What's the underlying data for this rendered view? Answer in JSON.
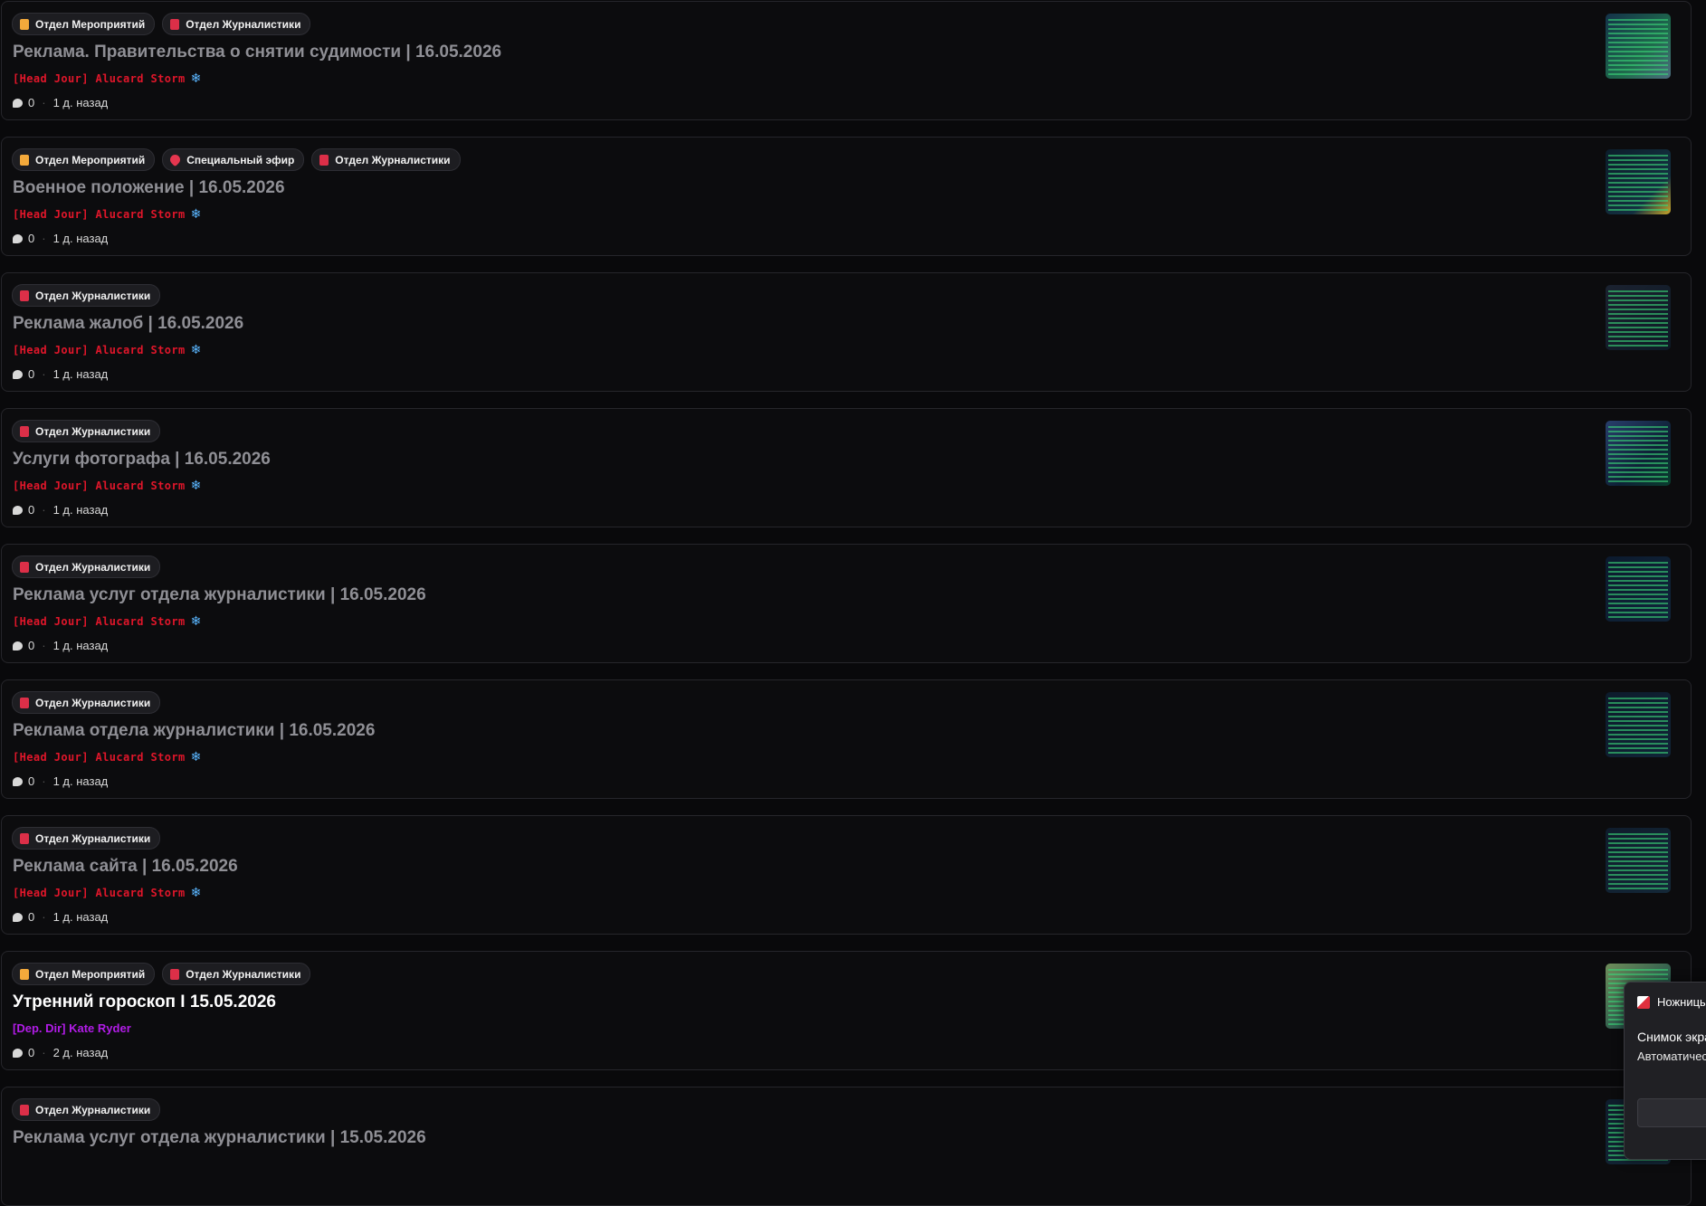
{
  "posts": [
    {
      "tags": [
        {
          "label": "Отдел Мероприятий",
          "icon": "folder-icon"
        },
        {
          "label": "Отдел Журналистики",
          "icon": "book-icon"
        }
      ],
      "title": "Реклама. Правительства о снятии судимости | 16.05.2026",
      "unread": false,
      "author": "[Head Jour] Alucard Storm",
      "author_style": "red",
      "has_snowflake": true,
      "comments": "0",
      "time": "1 д. назад"
    },
    {
      "tags": [
        {
          "label": "Отдел Мероприятий",
          "icon": "folder-icon"
        },
        {
          "label": "Специальный эфир",
          "icon": "heart-icon"
        },
        {
          "label": "Отдел Журналистики",
          "icon": "book-icon"
        }
      ],
      "title": "Военное положение | 16.05.2026",
      "unread": false,
      "author": "[Head Jour] Alucard Storm",
      "author_style": "red",
      "has_snowflake": true,
      "comments": "0",
      "time": "1 д. назад"
    },
    {
      "tags": [
        {
          "label": "Отдел Журналистики",
          "icon": "book-icon"
        }
      ],
      "title": "Реклама жалоб | 16.05.2026",
      "unread": false,
      "author": "[Head Jour] Alucard Storm",
      "author_style": "red",
      "has_snowflake": true,
      "comments": "0",
      "time": "1 д. назад"
    },
    {
      "tags": [
        {
          "label": "Отдел Журналистики",
          "icon": "book-icon"
        }
      ],
      "title": "Услуги фотографа | 16.05.2026",
      "unread": false,
      "author": "[Head Jour] Alucard Storm",
      "author_style": "red",
      "has_snowflake": true,
      "comments": "0",
      "time": "1 д. назад"
    },
    {
      "tags": [
        {
          "label": "Отдел Журналистики",
          "icon": "book-icon"
        }
      ],
      "title": "Реклама услуг отдела журналистики | 16.05.2026",
      "unread": false,
      "author": "[Head Jour] Alucard Storm",
      "author_style": "red",
      "has_snowflake": true,
      "comments": "0",
      "time": "1 д. назад"
    },
    {
      "tags": [
        {
          "label": "Отдел Журналистики",
          "icon": "book-icon"
        }
      ],
      "title": "Реклама отдела журналистики | 16.05.2026",
      "unread": false,
      "author": "[Head Jour] Alucard Storm",
      "author_style": "red",
      "has_snowflake": true,
      "comments": "0",
      "time": "1 д. назад"
    },
    {
      "tags": [
        {
          "label": "Отдел Журналистики",
          "icon": "book-icon"
        }
      ],
      "title": "Реклама сайта | 16.05.2026",
      "unread": false,
      "author": "[Head Jour] Alucard Storm",
      "author_style": "red",
      "has_snowflake": true,
      "comments": "0",
      "time": "1 д. назад"
    },
    {
      "tags": [
        {
          "label": "Отдел Мероприятий",
          "icon": "folder-icon"
        },
        {
          "label": "Отдел Журналистики",
          "icon": "book-icon"
        }
      ],
      "title": "Утренний гороскоп I 15.05.2026",
      "unread": true,
      "author": "[Dep. Dir] Kate Ryder",
      "author_style": "purple",
      "has_snowflake": false,
      "comments": "0",
      "time": "2 д. назад"
    },
    {
      "tags": [
        {
          "label": "Отдел Журналистики",
          "icon": "book-icon"
        }
      ],
      "title": "Реклама услуг отдела журналистики | 15.05.2026",
      "unread": false,
      "author": "",
      "author_style": "red",
      "has_snowflake": false,
      "comments": "",
      "time": ""
    }
  ],
  "notification": {
    "app_name": "Ножницы",
    "app_icon": "scissors-app-icon",
    "title": "Снимок экра",
    "body": "Автоматичес экрана."
  },
  "colors": {
    "background": "#09090b",
    "card_border": "#26262b",
    "author_red": "#e0162a",
    "author_purple": "#b21ce8",
    "snowflake": "#5ab6ff"
  }
}
